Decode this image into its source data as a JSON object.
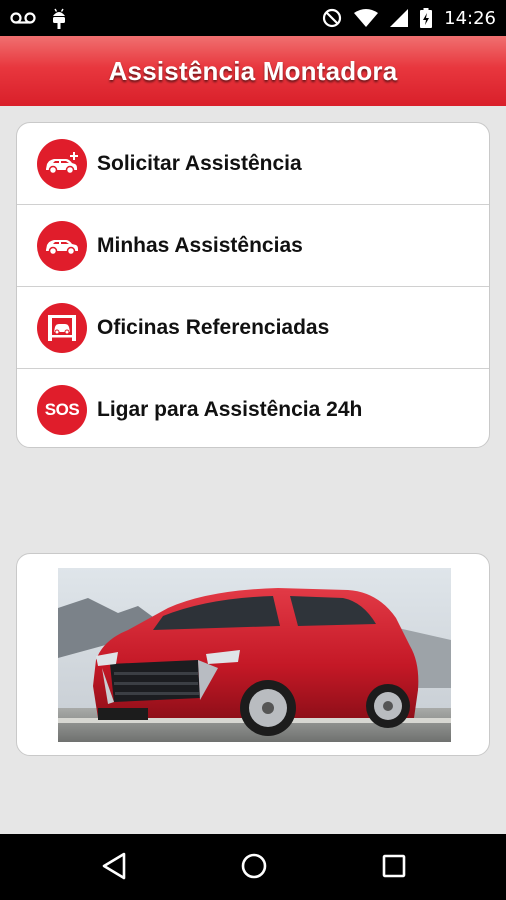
{
  "status_bar": {
    "time": "14:26",
    "icons": [
      "voicemail-icon",
      "android-debug-icon",
      "do-not-disturb-icon",
      "wifi-icon",
      "cellular-signal-icon",
      "battery-charging-icon"
    ]
  },
  "app_bar": {
    "title": "Assistência Montadora"
  },
  "menu": {
    "items": [
      {
        "label": "Solicitar Assistência",
        "icon": "car-plus-icon"
      },
      {
        "label": "Minhas Assistências",
        "icon": "car-icon"
      },
      {
        "label": "Oficinas Referenciadas",
        "icon": "car-lift-icon"
      },
      {
        "label": "Ligar para Assistência 24h",
        "icon": "sos-icon",
        "icon_text": "SOS"
      }
    ]
  },
  "banner": {
    "image": "red-suv-photo"
  },
  "nav_bar": {
    "buttons": [
      "back-icon",
      "home-icon",
      "recent-apps-icon"
    ]
  },
  "colors": {
    "brand_red": "#e01d2b",
    "background": "#e6e6e6"
  }
}
